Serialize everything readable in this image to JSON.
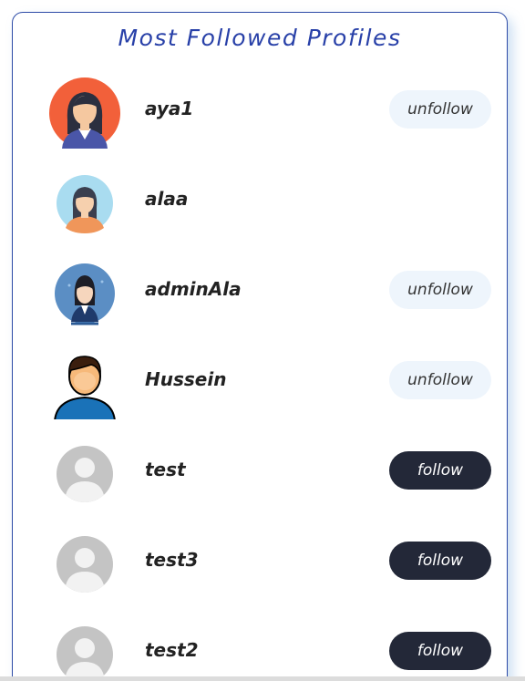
{
  "title": "Most Followed Profiles",
  "colors": {
    "accent": "#2840a8",
    "follow_bg": "#232838",
    "unfollow_bg": "#eef5fc"
  },
  "profiles": [
    {
      "username": "aya1",
      "action": "unfollow",
      "avatar": "woman-orange-avatar"
    },
    {
      "username": "alaa",
      "action": "",
      "avatar": "woman-blue-avatar"
    },
    {
      "username": "adminAla",
      "action": "unfollow",
      "avatar": "woman-suit-avatar"
    },
    {
      "username": "Hussein",
      "action": "unfollow",
      "avatar": "man-cartoon-avatar"
    },
    {
      "username": "test",
      "action": "follow",
      "avatar": "default-user-avatar"
    },
    {
      "username": "test3",
      "action": "follow",
      "avatar": "default-user-avatar"
    },
    {
      "username": "test2",
      "action": "follow",
      "avatar": "default-user-avatar"
    }
  ]
}
